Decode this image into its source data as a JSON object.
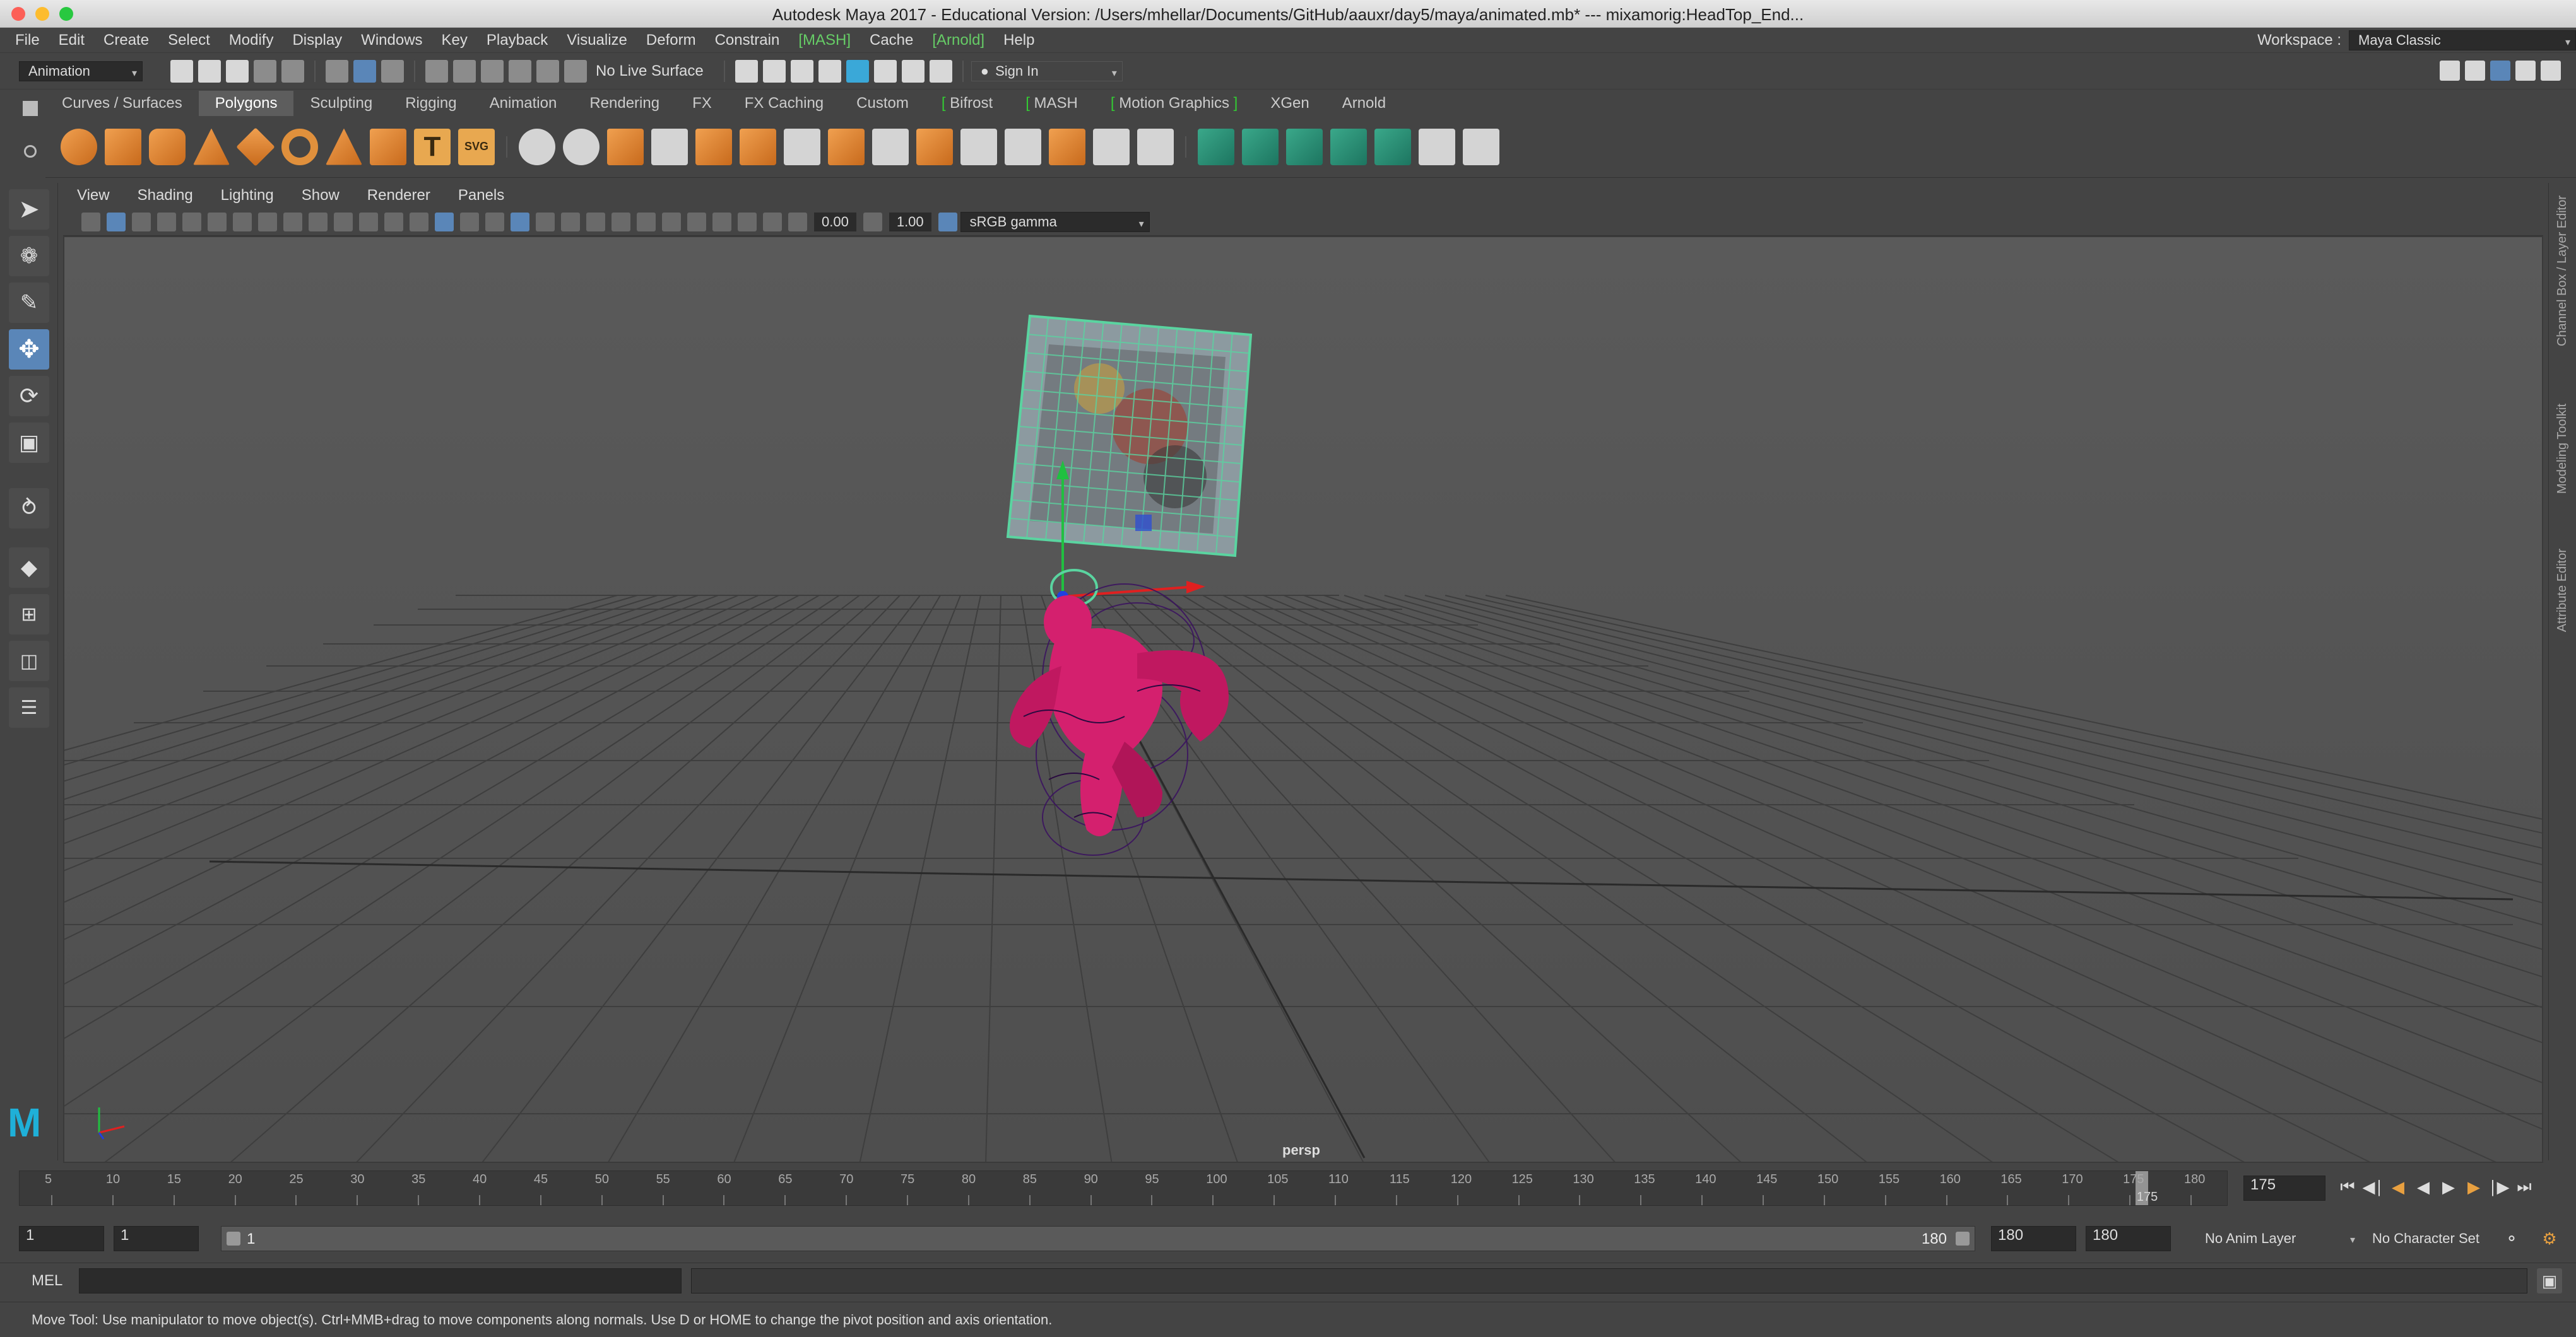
{
  "window": {
    "title": "Autodesk Maya 2017 - Educational Version: /Users/mhellar/Documents/GitHub/aauxr/day5/maya/animated.mb*   ---   mixamorig:HeadTop_End..."
  },
  "menubar": {
    "items": [
      "File",
      "Edit",
      "Create",
      "Select",
      "Modify",
      "Display",
      "Windows",
      "Key",
      "Playback",
      "Visualize",
      "Deform",
      "Constrain"
    ],
    "mash": "[MASH]",
    "cache": "Cache",
    "arnold": "[Arnold]",
    "help": "Help",
    "workspace_label": "Workspace :",
    "workspace_value": "Maya Classic"
  },
  "statusline": {
    "menuset": "Animation",
    "live_surface": "No Live Surface",
    "sign_in": "Sign In"
  },
  "shelf": {
    "tabs": [
      "Curves / Surfaces",
      "Polygons",
      "Sculpting",
      "Rigging",
      "Animation",
      "Rendering",
      "FX",
      "FX Caching",
      "Custom",
      "Bifrost",
      "MASH",
      "Motion Graphics",
      "XGen",
      "Arnold"
    ],
    "active_tab": "Polygons",
    "svg_label": "SVG"
  },
  "panel": {
    "menus": [
      "View",
      "Shading",
      "Lighting",
      "Show",
      "Renderer",
      "Panels"
    ],
    "exposure": "0.00",
    "gamma": "1.00",
    "color_space": "sRGB gamma",
    "camera_label": "persp"
  },
  "right_panels": [
    "Channel Box / Layer Editor",
    "Modeling Toolkit",
    "Attribute Editor"
  ],
  "timeline": {
    "ticks": [
      "5",
      "10",
      "15",
      "20",
      "25",
      "30",
      "35",
      "40",
      "45",
      "50",
      "55",
      "60",
      "65",
      "70",
      "75",
      "80",
      "85",
      "90",
      "95",
      "100",
      "105",
      "110",
      "115",
      "120",
      "125",
      "130",
      "135",
      "140",
      "145",
      "150",
      "155",
      "160",
      "165",
      "170",
      "175",
      "180"
    ],
    "current_frame_marker": "175",
    "current_frame": "175",
    "current_frame_progress": 0.972
  },
  "range": {
    "start": "1",
    "playback_start": "1",
    "slider_start": "1",
    "slider_end": "180",
    "playback_end": "180",
    "end": "180",
    "anim_layer": "No Anim Layer",
    "char_set": "No Character Set"
  },
  "cmdline": {
    "lang": "MEL"
  },
  "helpline": {
    "text": "Move Tool: Use manipulator to move object(s). Ctrl+MMB+drag to move components along normals. Use D or HOME to change the pivot position and axis orientation."
  },
  "colors": {
    "character": "#d4206e",
    "manip_x": "#e02020",
    "manip_y": "#20c040",
    "manip_z": "#2040e0",
    "selection": "#5ad4a0"
  }
}
